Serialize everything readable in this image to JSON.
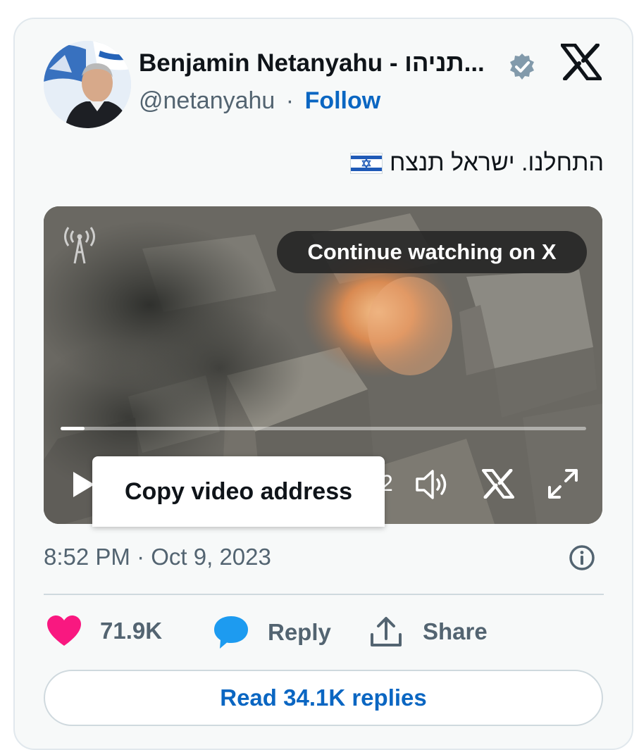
{
  "author": {
    "display_name": "Benjamin Netanyahu - תניהו...",
    "handle": "@netanyahu",
    "separator": "·",
    "follow_label": "Follow"
  },
  "tweet": {
    "text": "התחלנו. ישראל תנצח"
  },
  "video": {
    "continue_label": "Continue watching on X",
    "progress": 0.045,
    "time_fragment": "2",
    "context_menu_item": "Copy video address"
  },
  "meta": {
    "time": "8:52 PM",
    "separator": "·",
    "date": "Oct 9, 2023"
  },
  "actions": {
    "likes": "71.9K",
    "reply_label": "Reply",
    "share_label": "Share"
  },
  "read_replies_label": "Read 34.1K replies",
  "colors": {
    "accent": "#0a66c2",
    "like": "#f91880",
    "reply_icon": "#1d9bf0",
    "muted": "#536471",
    "verified": "#829aab"
  },
  "icons": [
    "verified-badge-icon",
    "x-logo-icon",
    "israel-flag-icon",
    "broadcast-watermark-icon",
    "play-icon",
    "volume-icon",
    "x-player-icon",
    "fullscreen-icon",
    "info-icon",
    "heart-icon",
    "reply-bubble-icon",
    "share-icon"
  ]
}
